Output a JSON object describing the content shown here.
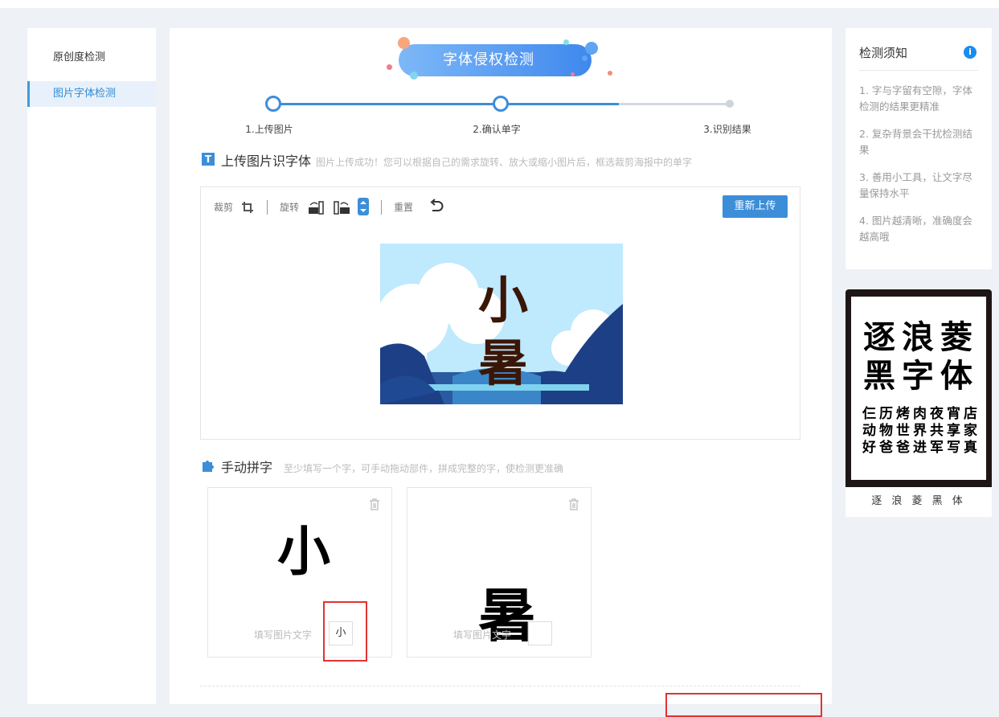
{
  "sidebar": {
    "items": [
      {
        "label": "原创度检测"
      },
      {
        "label": "图片字体检测"
      }
    ]
  },
  "banner": {
    "title": "字体侵权检测"
  },
  "steps": [
    {
      "label": "1.上传图片"
    },
    {
      "label": "2.确认单字"
    },
    {
      "label": "3.识别结果"
    }
  ],
  "upload_section": {
    "title": "上传图片识字体",
    "hint": "图片上传成功！您可以根据自己的需求旋转、放大或缩小图片后，框选裁剪海报中的单字"
  },
  "toolbar": {
    "crop": "裁剪",
    "rotate": "旋转",
    "reset": "重置",
    "reupload": "重新上传"
  },
  "preview": {
    "chars": [
      "小",
      "暑"
    ]
  },
  "manual_section": {
    "title": "手动拼字",
    "hint": "至少填写一个字，可手动拖动部件，拼成完整的字，使检测更准确"
  },
  "pieces": [
    {
      "glyph": "小",
      "fill_label": "填写图片文字",
      "value": "小"
    },
    {
      "glyph": "暑",
      "fill_label": "填写图片文字",
      "value": ""
    }
  ],
  "notice": {
    "title": "检测须知",
    "items": [
      "1. 字与字留有空隙，字体检测的结果更精准",
      "2. 复杂背景会干扰检测结果",
      "3. 善用小工具，让文字尽量保持水平",
      "4. 图片越清晰，准确度会越高哦"
    ]
  },
  "font_card": {
    "name": "逐 浪 菱 黑 体",
    "big_chars": [
      "逐",
      "浪",
      "菱",
      "黑",
      "字",
      "体"
    ],
    "small_chars": [
      "仨",
      "历",
      "烤",
      "肉",
      "夜",
      "宵",
      "店",
      "动",
      "物",
      "世",
      "界",
      "共",
      "享",
      "家",
      "好",
      "爸",
      "爸",
      "进",
      "军",
      "写",
      "真"
    ]
  },
  "colors": {
    "accent": "#3d8ed8",
    "highlight": "#e03333"
  }
}
